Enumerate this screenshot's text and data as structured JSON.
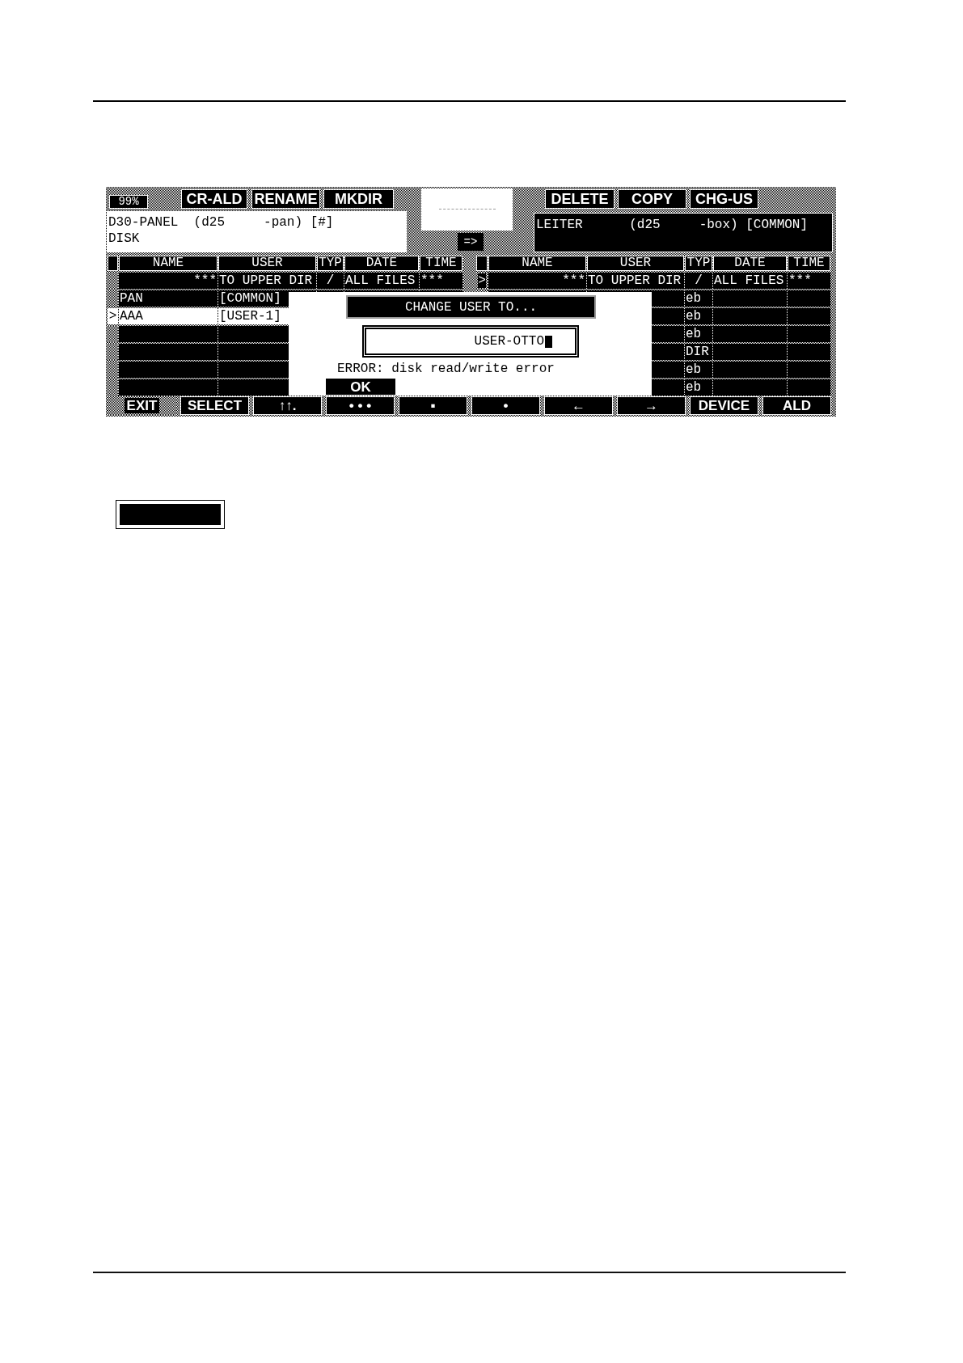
{
  "percent_display": "99%",
  "left_buttons": [
    "CR-ALD",
    "RENAME",
    "MKDIR"
  ],
  "transfer_button": "=>",
  "right_buttons": [
    "DELETE",
    "COPY",
    "CHG-US"
  ],
  "left_pane": {
    "active": true,
    "info": [
      "D30-PANEL  (d25     -pan) [#]",
      "DISK"
    ],
    "columns": [
      "NAME",
      "USER",
      "TYP",
      "DATE",
      "TIME"
    ],
    "rows": [
      {
        "kind": "parent",
        "name": "***",
        "user": "TO UPPER DIR",
        "typ": "/",
        "date": "ALL FILES",
        "time": "***",
        "selected": false
      },
      {
        "kind": "entry",
        "name": "PAN",
        "user": "[COMMON]",
        "selected": false
      },
      {
        "kind": "entry",
        "marker": ">",
        "name": "AAA",
        "user": "[USER-1]",
        "selected": true
      },
      {
        "kind": "entry",
        "selected": false
      },
      {
        "kind": "entry",
        "selected": false
      },
      {
        "kind": "entry",
        "selected": false
      },
      {
        "kind": "entry",
        "selected": false
      }
    ]
  },
  "right_pane": {
    "active": false,
    "info": [
      "LEITER      (d25     -box) [COMMON]"
    ],
    "columns": [
      "NAME",
      "USER",
      "TYP",
      "DATE",
      "TIME"
    ],
    "rows": [
      {
        "kind": "parent",
        "marker": ">",
        "name": "***",
        "user": "TO UPPER DIR",
        "typ": "/",
        "date": "ALL FILES",
        "time": "***",
        "selected": false
      },
      {
        "kind": "entry",
        "typ": "eb",
        "selected": false
      },
      {
        "kind": "entry",
        "typ": "eb",
        "selected": false
      },
      {
        "kind": "entry",
        "typ": "eb",
        "selected": false
      },
      {
        "kind": "entry",
        "typ": "DIR",
        "selected": false
      },
      {
        "kind": "entry",
        "typ": "eb",
        "selected": false
      },
      {
        "kind": "entry",
        "typ": "eb",
        "selected": false
      }
    ]
  },
  "dialog": {
    "title": "CHANGE USER TO...",
    "input_value": "USER-OTTO",
    "error": "ERROR: disk read/write error",
    "ok_button": "OK"
  },
  "function_keys": [
    {
      "label": "EXIT",
      "highlighted": true
    },
    {
      "label": "SELECT",
      "highlighted": false
    },
    {
      "label": "↑↑.",
      "highlighted": false
    },
    {
      "label": "• • •",
      "highlighted": false
    },
    {
      "label": "▪",
      "highlighted": false
    },
    {
      "label": "•",
      "highlighted": false
    },
    {
      "label": "←",
      "highlighted": false
    },
    {
      "label": "→",
      "highlighted": false
    },
    {
      "label": "DEVICE",
      "highlighted": false
    },
    {
      "label": "ALD",
      "highlighted": false
    }
  ]
}
